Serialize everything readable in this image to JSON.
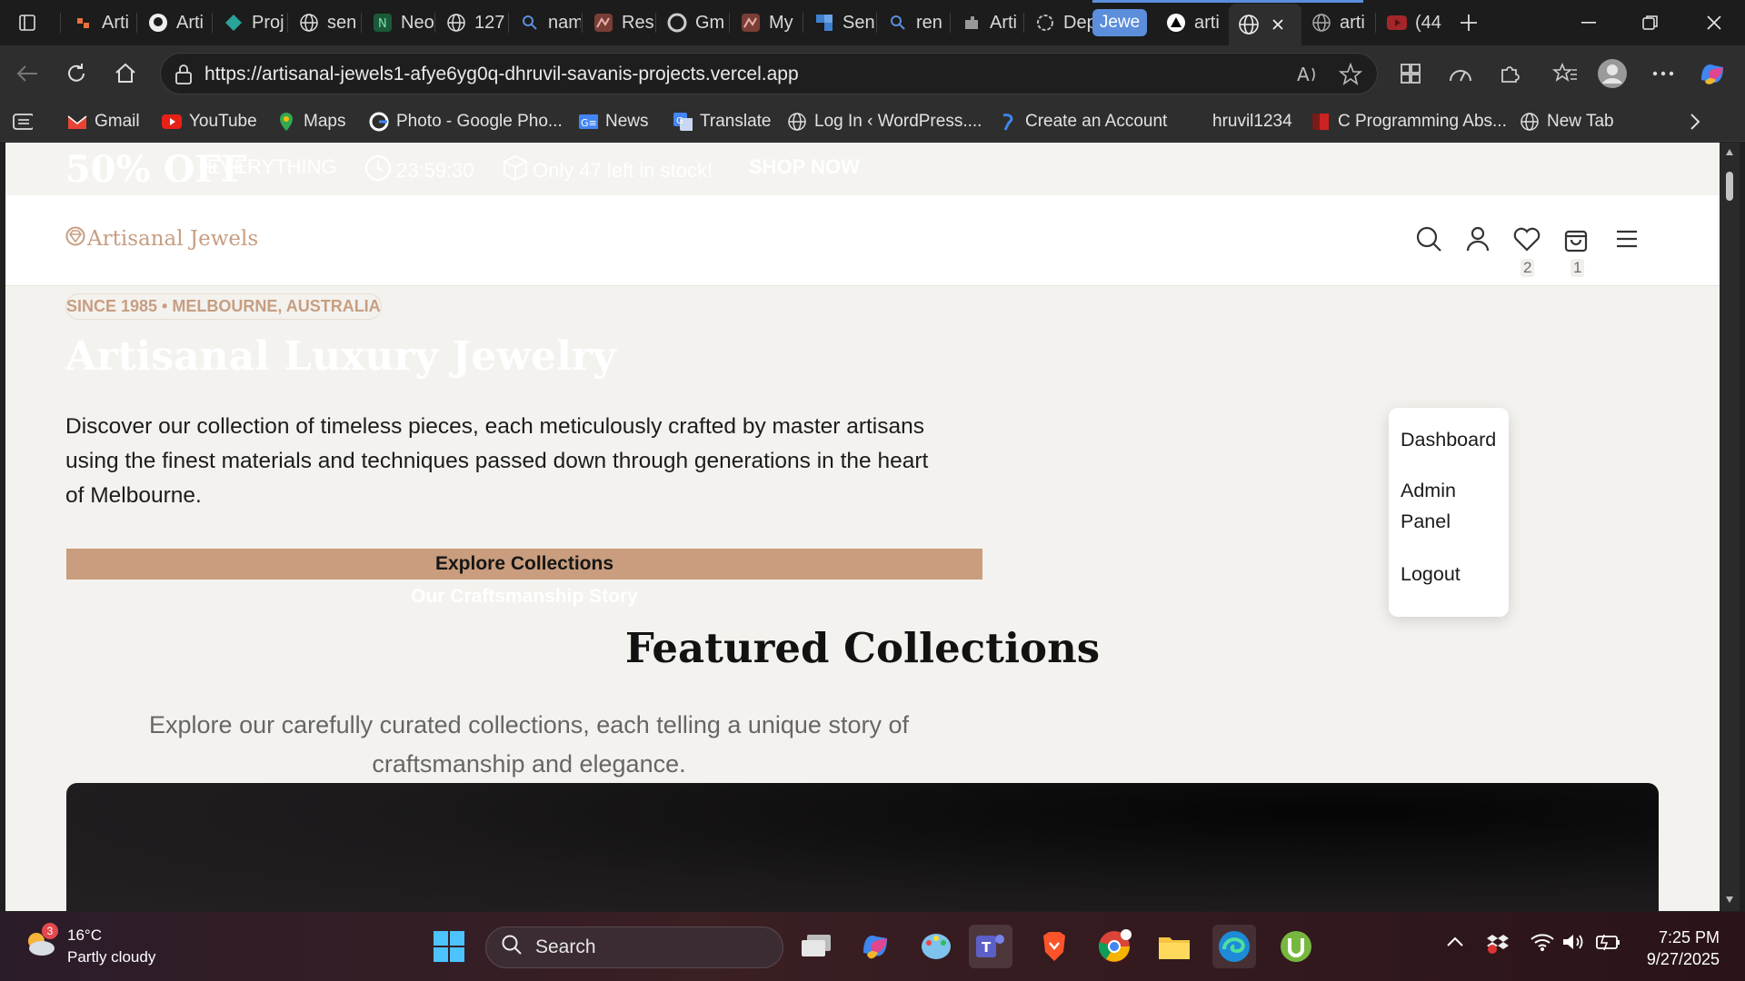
{
  "browser": {
    "tabs": [
      {
        "label": "Arti",
        "icon": "app-icon"
      },
      {
        "label": "Arti",
        "icon": "github-icon"
      },
      {
        "label": "Proj",
        "icon": "diamond-icon"
      },
      {
        "label": "sen",
        "icon": "globe-icon"
      },
      {
        "label": "Neo",
        "icon": "neo-icon"
      },
      {
        "label": "127",
        "icon": "globe-icon"
      },
      {
        "label": "nam",
        "icon": "search-icon"
      },
      {
        "label": "Res",
        "icon": "render-icon"
      },
      {
        "label": "Gm",
        "icon": "google-icon"
      },
      {
        "label": "My",
        "icon": "render-icon"
      },
      {
        "label": "Sen",
        "icon": "grid-icon"
      },
      {
        "label": "ren",
        "icon": "search-icon"
      },
      {
        "label": "Arti",
        "icon": "puzzle-icon"
      },
      {
        "label": "Dep",
        "icon": "openai-icon"
      },
      {
        "label": "Jewe",
        "icon": "group-label"
      },
      {
        "label": "arti",
        "icon": "vercel-icon"
      },
      {
        "label": "",
        "icon": "globe-icon"
      },
      {
        "label": "arti",
        "icon": "globe-icon"
      },
      {
        "label": "(44",
        "icon": "youtube-icon"
      }
    ],
    "url": "https://artisanal-jewels1-afye6yg0q-dhruvil-savanis-projects.vercel.app",
    "bookmarks": [
      {
        "label": "Gmail",
        "icon": "gmail-icon"
      },
      {
        "label": "YouTube",
        "icon": "youtube-icon"
      },
      {
        "label": "Maps",
        "icon": "maps-icon"
      },
      {
        "label": "Photo - Google Pho...",
        "icon": "google-icon"
      },
      {
        "label": "News",
        "icon": "news-icon"
      },
      {
        "label": "Translate",
        "icon": "translate-icon"
      },
      {
        "label": "Log In ‹ WordPress....",
        "icon": "globe-icon"
      },
      {
        "label": "Create an Account",
        "icon": "link-icon"
      },
      {
        "label": "hruvil1234",
        "icon": "none"
      },
      {
        "label": "C Programming Abs...",
        "icon": "pdf-icon"
      },
      {
        "label": "New Tab",
        "icon": "globe-icon"
      }
    ]
  },
  "site": {
    "promo": {
      "off": "50% OFF",
      "everything": "EVERYTHING",
      "timer": "23:59:30",
      "stock": "Only 47 left in stock!",
      "cta": "SHOP NOW"
    },
    "logo": "Artisanal Jewels",
    "wishlist_count": "2",
    "cart_count": "1",
    "menu": [
      "Dashboard",
      "Admin",
      "Panel",
      "Logout"
    ],
    "hero": {
      "tag": "SINCE 1985 • MELBOURNE, AUSTRALIA",
      "title": "Artisanal Luxury Jewelry",
      "desc_lines": [
        "Discover our collection of timeless pieces, each meticulously crafted by master artisans",
        "using the finest materials and techniques passed down through generations in the heart",
        "of Melbourne."
      ],
      "primary_btn": "Explore Collections",
      "secondary_btn": "Our Craftsmanship Story"
    },
    "featured": {
      "title": "Featured Collections",
      "sub_lines": [
        "Explore our carefully curated collections, each telling a unique story of",
        "craftsmanship and elegance."
      ]
    }
  },
  "taskbar": {
    "weather_temp": "16°C",
    "weather_desc": "Partly cloudy",
    "weather_badge": "3",
    "search": "Search",
    "time": "7:25 PM",
    "date": "9/27/2025"
  },
  "colors": {
    "accent": "#c99d7d",
    "logo": "#c79e82",
    "page_bg": "#f4f2ee"
  }
}
